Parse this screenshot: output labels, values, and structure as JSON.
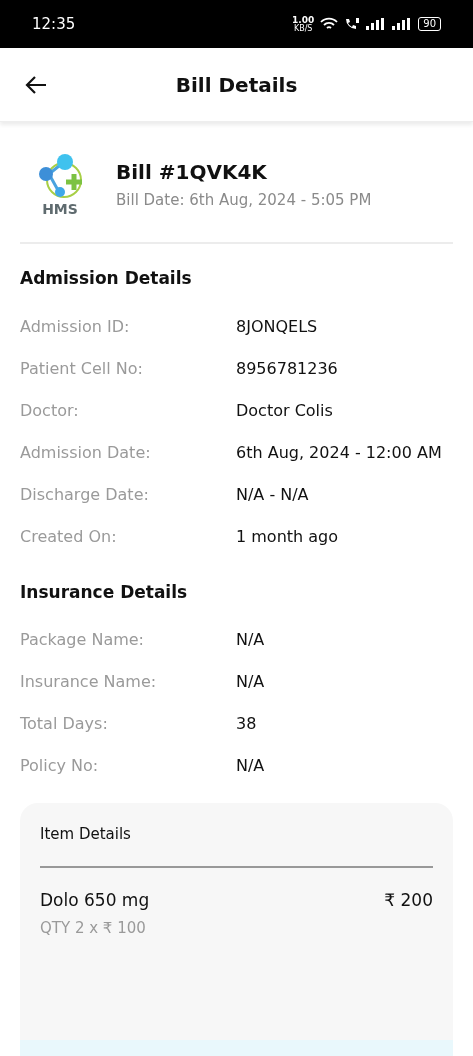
{
  "status_bar": {
    "time": "12:35",
    "speed": "1.00",
    "speed_unit": "KB/S",
    "battery": "90"
  },
  "header": {
    "title": "Bill Details"
  },
  "bill": {
    "logo_text": "HMS",
    "title": "Bill #1QVK4K",
    "date": "Bill Date: 6th Aug, 2024 - 5:05 PM"
  },
  "sections": [
    {
      "title": "Admission Details",
      "rows": [
        {
          "label": "Admission ID:",
          "value": "8JONQELS"
        },
        {
          "label": "Patient Cell No:",
          "value": "8956781236"
        },
        {
          "label": "Doctor:",
          "value": "Doctor Colis"
        },
        {
          "label": "Admission Date:",
          "value": "6th Aug, 2024 - 12:00 AM"
        },
        {
          "label": "Discharge Date:",
          "value": "N/A - N/A"
        },
        {
          "label": "Created On:",
          "value": "1 month ago"
        }
      ]
    },
    {
      "title": "Insurance Details",
      "rows": [
        {
          "label": "Package Name:",
          "value": "N/A"
        },
        {
          "label": "Insurance Name:",
          "value": "N/A"
        },
        {
          "label": "Total Days:",
          "value": "38"
        },
        {
          "label": "Policy No:",
          "value": "N/A"
        }
      ]
    }
  ],
  "items": {
    "title": "Item Details",
    "list": [
      {
        "name": "Dolo 650 mg",
        "amount": "₹ 200",
        "qty": "QTY 2 x ₹ 100"
      }
    ]
  }
}
